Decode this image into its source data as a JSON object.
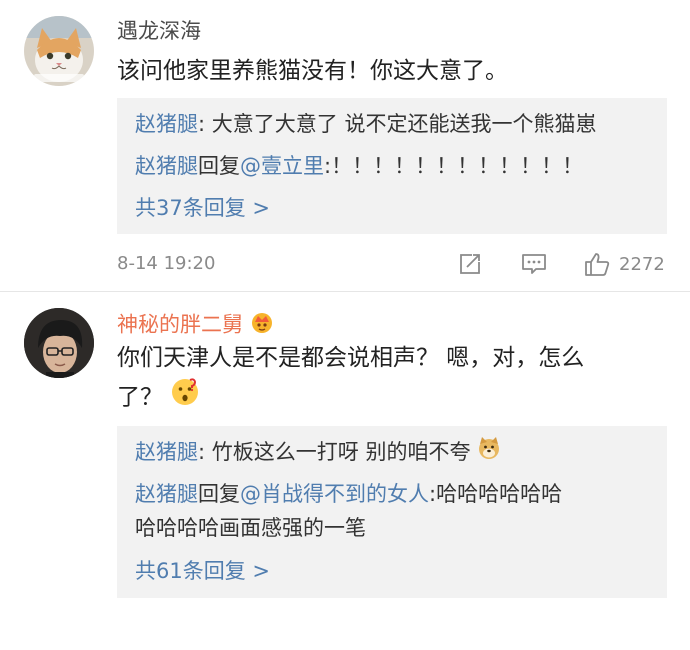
{
  "comments": [
    {
      "username": "遇龙深海",
      "text": "该问他家里养熊猫没有！你这大意了。",
      "replies": [
        {
          "author": "赵猪腿",
          "sep": ": ",
          "content": "大意了大意了 说不定还能送我一个熊猫崽"
        },
        {
          "author": "赵猪腿",
          "verb": "回复",
          "mention": "@壹立里",
          "content": ":！！！！！！！！！！！！"
        }
      ],
      "more_replies": "共37条回复 >",
      "timestamp": "8-14 19:20",
      "like_count": "2272"
    },
    {
      "username": "神秘的胖二舅",
      "text_line1": "你们天津人是不是都会说相声？ 嗯，对，怎么",
      "text_line2": "了？",
      "replies": [
        {
          "author": "赵猪腿",
          "sep": ": ",
          "content": "竹板这么一打呀 别的咱不夸"
        },
        {
          "author": "赵猪腿",
          "verb": "回复",
          "mention": "@肖战得不到的女人",
          "content": ":哈哈哈哈哈哈",
          "content2": "哈哈哈哈画面感强的一笔"
        }
      ],
      "more_replies": "共61条回复 >"
    }
  ],
  "icons": {
    "avatar1": "cat-avatar",
    "avatar2": "person-with-glasses-avatar",
    "vip": "vip-crown-badge-icon",
    "share": "share-icon",
    "comment": "comment-icon",
    "like": "thumbs-up-icon",
    "emoji1": "thinking-face-emoji",
    "emoji2": "doge-emoji"
  },
  "colors": {
    "link_blue": "#507daf",
    "vip_orange": "#eb7350",
    "reply_bg": "#f2f2f2",
    "meta_gray": "#8a8a8a"
  }
}
